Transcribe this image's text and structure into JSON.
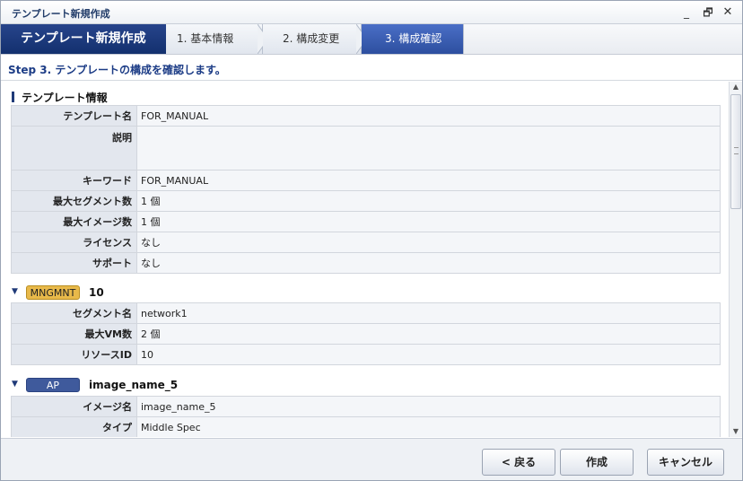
{
  "window": {
    "title": "テンプレート新規作成",
    "minimize_glyph": "_",
    "restore_glyph": "🗗",
    "close_glyph": "✕"
  },
  "wizard": {
    "title": "テンプレート新規作成",
    "steps": [
      {
        "label": "1. 基本情報",
        "active": false
      },
      {
        "label": "2. 構成変更",
        "active": false
      },
      {
        "label": "3. 構成確認",
        "active": true
      }
    ],
    "description": "Step 3. テンプレートの構成を確認します。"
  },
  "template_info": {
    "heading": "テンプレート情報",
    "rows": [
      {
        "label": "テンプレート名",
        "value": "FOR_MANUAL"
      },
      {
        "label": "説明",
        "value": ""
      },
      {
        "label": "キーワード",
        "value": "FOR_MANUAL"
      },
      {
        "label": "最大セグメント数",
        "value": "1 個"
      },
      {
        "label": "最大イメージ数",
        "value": "1 個"
      },
      {
        "label": "ライセンス",
        "value": "なし"
      },
      {
        "label": "サポート",
        "value": "なし"
      }
    ]
  },
  "segment": {
    "badge": "MNGMNT",
    "name": "10",
    "rows": [
      {
        "label": "セグメント名",
        "value": "network1"
      },
      {
        "label": "最大VM数",
        "value": "2 個"
      },
      {
        "label": "リソースID",
        "value": "10"
      }
    ]
  },
  "image": {
    "badge": "AP",
    "name": "image_name_5",
    "rows": [
      {
        "label": "イメージ名",
        "value": "image_name_5"
      },
      {
        "label": "タイプ",
        "value": "Middle Spec"
      }
    ]
  },
  "buttons": {
    "back": "< 戻る",
    "create": "作成",
    "cancel": "キャンセル"
  },
  "colors": {
    "accent": "#1f3a78",
    "active_step": "#3d60b5",
    "mngmnt_badge": "#e8b94a",
    "ap_badge": "#3f5a9c"
  }
}
